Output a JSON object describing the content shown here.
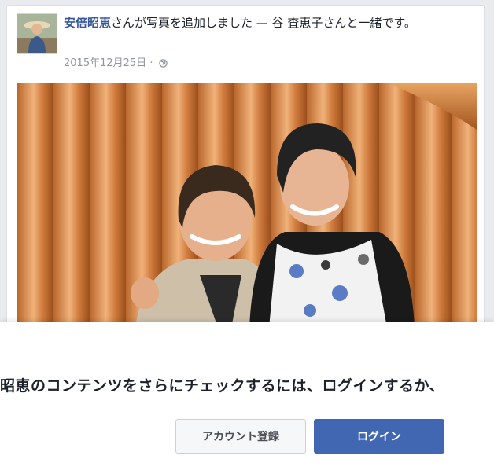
{
  "post": {
    "author": "安倍昭恵",
    "action": "さんが写真を追加しました — 谷 査恵子さんと一緒です。",
    "date": "2015年12月25日",
    "separator": "·",
    "privacy_icon": "globe-icon"
  },
  "login_prompt": {
    "message": "昭恵のコンテンツをさらにチェックするには、ログインするか、",
    "register_label": "アカウント登録",
    "login_label": "ログイン"
  },
  "colors": {
    "link": "#365899",
    "primary_button": "#4267b2",
    "meta_text": "#90949c",
    "background": "#e9ebee"
  }
}
